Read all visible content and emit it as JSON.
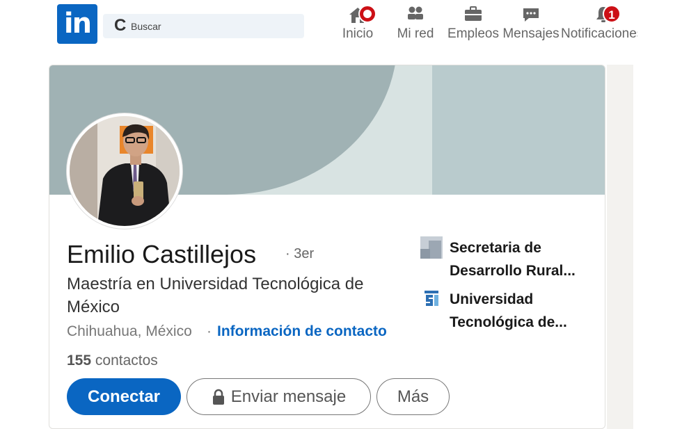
{
  "nav": {
    "logo_text": "in",
    "search_icon_glyph": "C",
    "search_placeholder": "Buscar",
    "items": [
      {
        "label": "Inicio",
        "icon": "home-icon",
        "badge": ""
      },
      {
        "label": "Mi red",
        "icon": "network-icon",
        "badge": ""
      },
      {
        "label": "Empleos",
        "icon": "briefcase-icon",
        "badge": ""
      },
      {
        "label": "Mensajes",
        "icon": "message-icon",
        "badge": ""
      },
      {
        "label": "Notificaciones",
        "icon": "bell-icon",
        "badge": "1"
      }
    ]
  },
  "profile": {
    "name": "Emilio Castillejos",
    "degree": "· 3er",
    "headline": "Maestría en Universidad Tecnológica de México",
    "location": "Chihuahua, México",
    "separator": "·",
    "contact_link": "Información de contacto",
    "connections_count": "155",
    "connections_label": "contactos",
    "experience": [
      {
        "name": "Secretaria de Desarrollo Rural...",
        "icon": "organization-logo-icon"
      },
      {
        "name": "Universidad Tecnológica de...",
        "icon": "university-logo-icon"
      }
    ]
  },
  "actions": {
    "connect": "Conectar",
    "message": "Enviar mensaje",
    "more": "Más"
  },
  "colors": {
    "brand": "#0a66c2",
    "badge": "#cc1016",
    "banner_dark": "#a0b2b4",
    "banner_light": "#d8e3e2"
  }
}
